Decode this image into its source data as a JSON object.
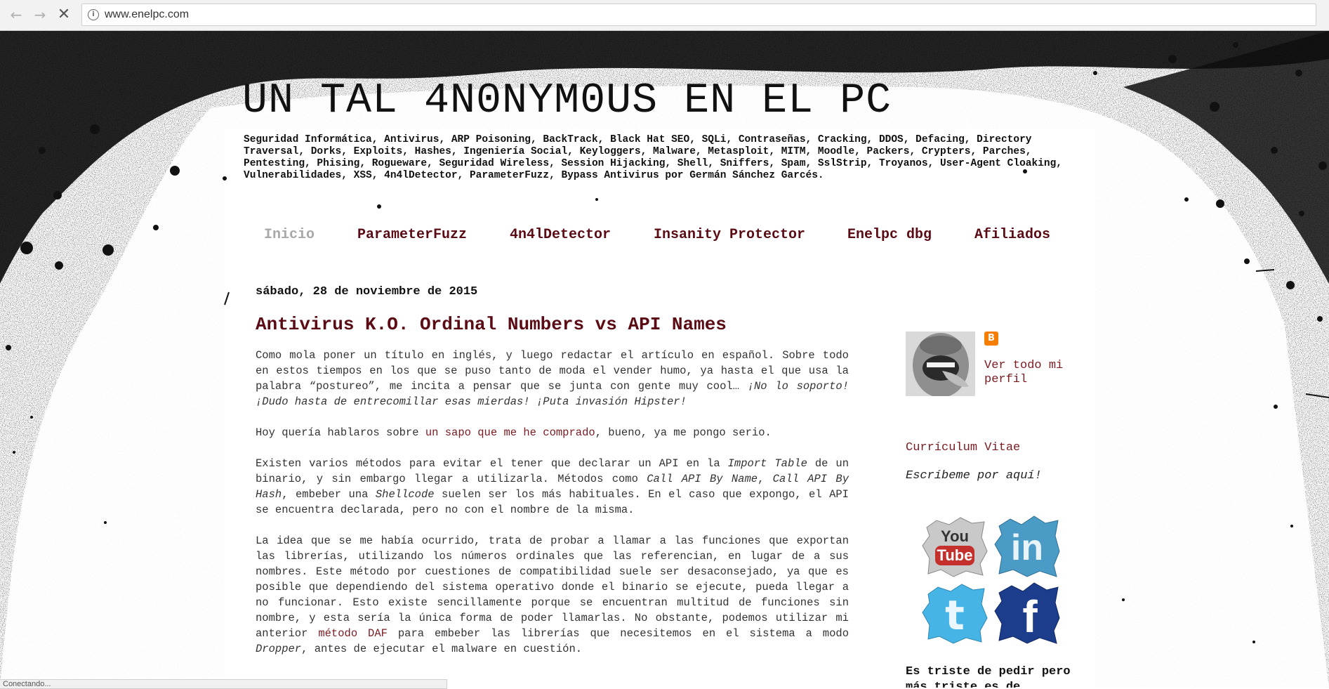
{
  "browser": {
    "url": "www.enelpc.com",
    "status": "Conectando..."
  },
  "blog": {
    "title": "UN TAL 4N0NYM0US EN EL PC",
    "tagline": "Seguridad Informática, Antivirus, ARP Poisoning, BackTrack, Black Hat SEO, SQLi, Contraseñas, Cracking, DDOS, Defacing, Directory Traversal, Dorks, Exploits, Hashes, Ingeniería Social, Keyloggers, Malware, Metasploit, MITM, Moodle, Packers, Crypters, Parches, Pentesting, Phising, Rogueware, Seguridad Wireless, Session Hijacking, Shell, Sniffers, Spam, SslStrip, Troyanos, User-Agent Cloaking, Vulnerabilidades, XSS, 4n4lDetector, ParameterFuzz, Bypass Antivirus por Germán Sánchez Garcés."
  },
  "menu": [
    "Inicio",
    "ParameterFuzz",
    "4n4lDetector",
    "Insanity Protector",
    "Enelpc dbg",
    "Afiliados"
  ],
  "post": {
    "date": "sábado, 28 de noviembre de 2015",
    "title": "Antivirus K.O. Ordinal Numbers vs API Names",
    "p1_a": "Como mola poner un título en inglés, y luego redactar el artículo en español. Sobre todo en estos tiempos en los que se puso tanto de moda el vender humo, ya hasta el que usa la palabra “postureo”, me incita a pensar que se junta con gente muy cool… ",
    "p1_b": "¡No lo soporto! ¡Dudo hasta de entrecomillar esas mierdas! ¡Puta invasión Hipster!",
    "p2_a": "Hoy quería hablaros sobre ",
    "p2_link": "un sapo que me he comprado",
    "p2_b": ", bueno, ya me pongo serio.",
    "p3_a": "Existen varios métodos para evitar el tener que declarar un API en la ",
    "p3_i1": "Import Table",
    "p3_b": " de un binario, y sin embargo llegar a utilizarla. Métodos como ",
    "p3_i2": "Call API By Name",
    "p3_c": ", ",
    "p3_i3": "Call API By Hash",
    "p3_d": ", embeber una ",
    "p3_i4": "Shellcode",
    "p3_e": " suelen ser los más habituales. En el caso que expongo, el API se encuentra declarada, pero no con el nombre de la misma.",
    "p4_a": "La idea que se me había ocurrido, trata de probar a llamar a las funciones que exportan las librerías, utilizando los números ordinales que las referencian, en lugar de a sus nombres. Este método por cuestiones de compatibilidad suele ser desaconsejado, ya que es posible que dependiendo del sistema operativo donde el binario se ejecute, pueda llegar a no funcionar. Esto existe sencillamente porque se encuentran multitud de funciones sin nombre, y esta sería la única forma de poder llamarlas. No obstante, podemos utilizar mi anterior ",
    "p4_link": "método DAF",
    "p4_b": " para embeber las librerías que necesitemos en el sistema a modo ",
    "p4_i": "Dropper",
    "p4_c": ", antes de ejecutar el malware en cuestión."
  },
  "sidebar": {
    "profile_link": "Ver todo mi perfil",
    "cv": "Currículum Vitae",
    "write_me": "Escríbeme por aquí!",
    "social": {
      "youtube_label": "You",
      "youtube_label2": "Tube",
      "linkedin_label": "in",
      "twitter_label": "t",
      "facebook_label": "f"
    },
    "widget_title": "Es triste de pedir pero más triste es de"
  },
  "colors": {
    "accent": "#5a0b14",
    "link": "#7a1b22",
    "menu_active": "#a8a8a8",
    "youtube_red": "#c4302b",
    "linkedin_blue": "#4a9bc6",
    "twitter_blue": "#47b4e6",
    "facebook_blue": "#1c3d8c"
  }
}
